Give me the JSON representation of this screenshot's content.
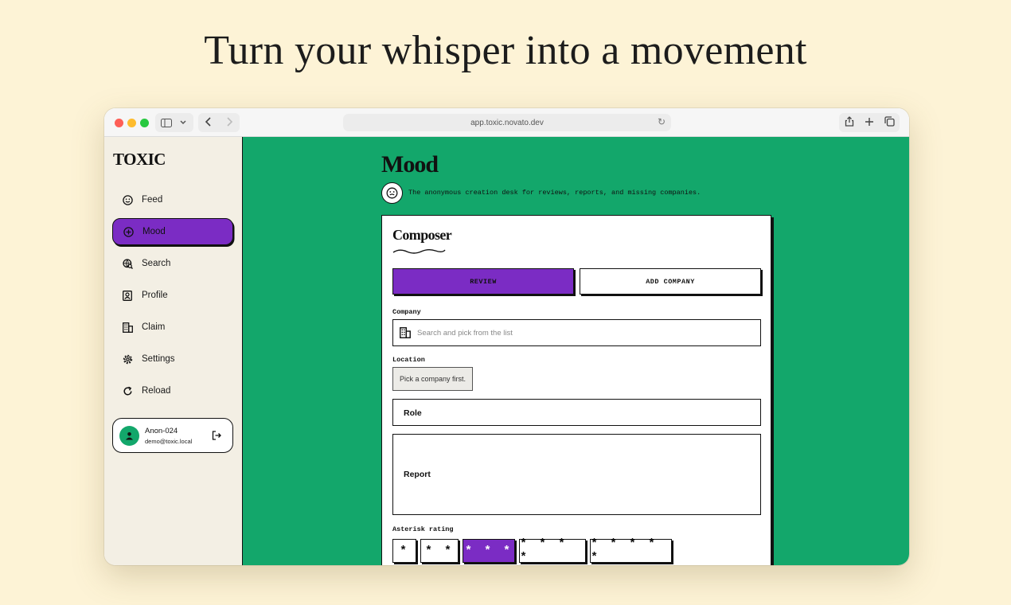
{
  "headline": "Turn your whisper into a movement",
  "browser": {
    "url": "app.toxic.novato.dev"
  },
  "sidebar": {
    "logo": "TOXIC",
    "items": [
      {
        "label": "Feed",
        "icon": "smile-icon"
      },
      {
        "label": "Mood",
        "icon": "plus-circle-icon",
        "active": true
      },
      {
        "label": "Search",
        "icon": "globe-search-icon"
      },
      {
        "label": "Profile",
        "icon": "profile-card-icon"
      },
      {
        "label": "Claim",
        "icon": "building-icon"
      },
      {
        "label": "Settings",
        "icon": "gear-icon"
      },
      {
        "label": "Reload",
        "icon": "reload-icon"
      }
    ],
    "user": {
      "name": "Anon-024",
      "email": "demo@toxic.local"
    }
  },
  "main": {
    "title": "Mood",
    "subtitle": "The anonymous creation desk for reviews, reports, and missing companies."
  },
  "composer": {
    "title": "Composer",
    "tabs": [
      {
        "label": "REVIEW",
        "active": true
      },
      {
        "label": "ADD COMPANY",
        "active": false
      }
    ],
    "company_label": "Company",
    "company_placeholder": "Search and pick from the list",
    "location_label": "Location",
    "location_hint": "Pick a company first.",
    "role_label": "Role",
    "report_label": "Report",
    "rating_label": "Asterisk rating",
    "rating_options": [
      "*",
      "* *",
      "* * *",
      "* * * *",
      "* * * * *"
    ],
    "rating_selected": 3
  },
  "colors": {
    "background": "#fdf3d6",
    "main_green": "#13a76b",
    "accent_purple": "#7b2cc4",
    "sidebar_bg": "#f3efe4"
  }
}
